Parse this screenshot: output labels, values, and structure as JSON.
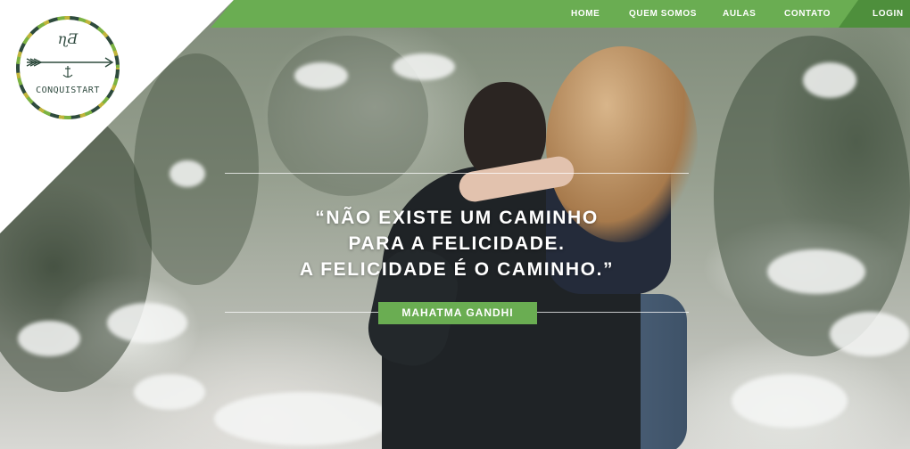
{
  "logo": {
    "monogram": "ɳƋ",
    "name": "CONQUISTART",
    "colors": {
      "dark": "#2e4b3d",
      "green": "#7cb342",
      "olive": "#c0b43a"
    }
  },
  "nav": {
    "accent": "#6aad52",
    "items": [
      {
        "label": "HOME"
      },
      {
        "label": "QUEM SOMOS"
      },
      {
        "label": "AULAS"
      },
      {
        "label": "CONTATO"
      }
    ],
    "login": "LOGIN"
  },
  "hero": {
    "quote_lines": [
      "“NÃO EXISTE UM CAMINHO",
      "PARA A FELICIDADE.",
      "A FELICIDADE É O CAMINHO.”"
    ],
    "author": "MAHATMA GANDHI"
  }
}
